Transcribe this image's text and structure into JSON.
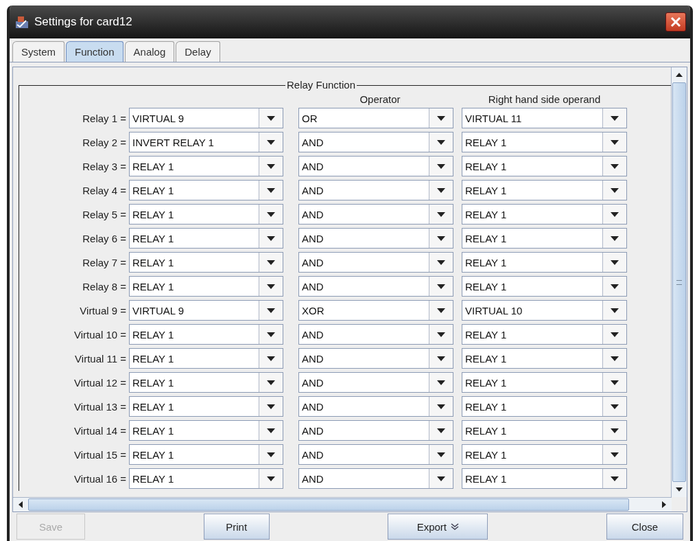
{
  "window": {
    "title": "Settings for card12"
  },
  "tabs": [
    {
      "label": "System",
      "selected": false
    },
    {
      "label": "Function",
      "selected": true
    },
    {
      "label": "Analog",
      "selected": false
    },
    {
      "label": "Delay",
      "selected": false
    }
  ],
  "group": {
    "title": "Relay Function",
    "headers": [
      "Operator",
      "Right hand side operand"
    ]
  },
  "rows": [
    {
      "label": "Relay 1 =",
      "left": "VIRTUAL 9",
      "operator": "OR",
      "right": "VIRTUAL 11"
    },
    {
      "label": "Relay 2 =",
      "left": "INVERT RELAY 1",
      "operator": "AND",
      "right": "RELAY 1"
    },
    {
      "label": "Relay 3 =",
      "left": "RELAY 1",
      "operator": "AND",
      "right": "RELAY 1"
    },
    {
      "label": "Relay 4 =",
      "left": "RELAY 1",
      "operator": "AND",
      "right": "RELAY 1"
    },
    {
      "label": "Relay 5 =",
      "left": "RELAY 1",
      "operator": "AND",
      "right": "RELAY 1"
    },
    {
      "label": "Relay 6 =",
      "left": "RELAY 1",
      "operator": "AND",
      "right": "RELAY 1"
    },
    {
      "label": "Relay 7 =",
      "left": "RELAY 1",
      "operator": "AND",
      "right": "RELAY 1"
    },
    {
      "label": "Relay 8 =",
      "left": "RELAY 1",
      "operator": "AND",
      "right": "RELAY 1"
    },
    {
      "label": "Virtual 9 =",
      "left": "VIRTUAL 9",
      "operator": "XOR",
      "right": "VIRTUAL 10"
    },
    {
      "label": "Virtual 10 =",
      "left": "RELAY 1",
      "operator": "AND",
      "right": "RELAY 1"
    },
    {
      "label": "Virtual 11 =",
      "left": "RELAY 1",
      "operator": "AND",
      "right": "RELAY 1"
    },
    {
      "label": "Virtual 12 =",
      "left": "RELAY 1",
      "operator": "AND",
      "right": "RELAY 1"
    },
    {
      "label": "Virtual 13 =",
      "left": "RELAY 1",
      "operator": "AND",
      "right": "RELAY 1"
    },
    {
      "label": "Virtual 14 =",
      "left": "RELAY 1",
      "operator": "AND",
      "right": "RELAY 1"
    },
    {
      "label": "Virtual 15 =",
      "left": "RELAY 1",
      "operator": "AND",
      "right": "RELAY 1"
    },
    {
      "label": "Virtual 16 =",
      "left": "RELAY 1",
      "operator": "AND",
      "right": "RELAY 1"
    }
  ],
  "buttons": [
    {
      "label": "Save",
      "disabled": true
    },
    {
      "label": "Print",
      "disabled": false
    },
    {
      "label": "Export",
      "disabled": false,
      "kind": "menu"
    },
    {
      "label": "Close",
      "disabled": false
    }
  ]
}
